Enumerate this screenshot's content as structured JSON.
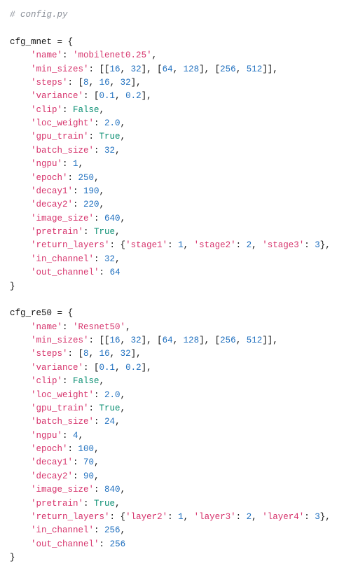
{
  "code": {
    "comment": "# config.py",
    "var1": "cfg_mnet",
    "var2": "cfg_re50",
    "mnet": {
      "name_k": "'name'",
      "name_v": "'mobilenet0.25'",
      "min_k": "'min_sizes'",
      "ms_a1": "16",
      "ms_a2": "32",
      "ms_b1": "64",
      "ms_b2": "128",
      "ms_c1": "256",
      "ms_c2": "512",
      "steps_k": "'steps'",
      "st_a": "8",
      "st_b": "16",
      "st_c": "32",
      "var_k": "'variance'",
      "va_a": "0.1",
      "va_b": "0.2",
      "clip_k": "'clip'",
      "clip_v": "False",
      "loc_k": "'loc_weight'",
      "loc_v": "2.0",
      "gpu_k": "'gpu_train'",
      "gpu_v": "True",
      "bs_k": "'batch_size'",
      "bs_v": "32",
      "ngpu_k": "'ngpu'",
      "ngpu_v": "1",
      "ep_k": "'epoch'",
      "ep_v": "250",
      "d1_k": "'decay1'",
      "d1_v": "190",
      "d2_k": "'decay2'",
      "d2_v": "220",
      "img_k": "'image_size'",
      "img_v": "640",
      "pre_k": "'pretrain'",
      "pre_v": "True",
      "rl_k": "'return_layers'",
      "rl_k1": "'stage1'",
      "rl_v1": "1",
      "rl_k2": "'stage2'",
      "rl_v2": "2",
      "rl_k3": "'stage3'",
      "rl_v3": "3",
      "in_k": "'in_channel'",
      "in_v": "32",
      "out_k": "'out_channel'",
      "out_v": "64"
    },
    "re50": {
      "name_k": "'name'",
      "name_v": "'Resnet50'",
      "min_k": "'min_sizes'",
      "ms_a1": "16",
      "ms_a2": "32",
      "ms_b1": "64",
      "ms_b2": "128",
      "ms_c1": "256",
      "ms_c2": "512",
      "steps_k": "'steps'",
      "st_a": "8",
      "st_b": "16",
      "st_c": "32",
      "var_k": "'variance'",
      "va_a": "0.1",
      "va_b": "0.2",
      "clip_k": "'clip'",
      "clip_v": "False",
      "loc_k": "'loc_weight'",
      "loc_v": "2.0",
      "gpu_k": "'gpu_train'",
      "gpu_v": "True",
      "bs_k": "'batch_size'",
      "bs_v": "24",
      "ngpu_k": "'ngpu'",
      "ngpu_v": "4",
      "ep_k": "'epoch'",
      "ep_v": "100",
      "d1_k": "'decay1'",
      "d1_v": "70",
      "d2_k": "'decay2'",
      "d2_v": "90",
      "img_k": "'image_size'",
      "img_v": "840",
      "pre_k": "'pretrain'",
      "pre_v": "True",
      "rl_k": "'return_layers'",
      "rl_k1": "'layer2'",
      "rl_v1": "1",
      "rl_k2": "'layer3'",
      "rl_v2": "2",
      "rl_k3": "'layer4'",
      "rl_v3": "3",
      "in_k": "'in_channel'",
      "in_v": "256",
      "out_k": "'out_channel'",
      "out_v": "256"
    }
  }
}
